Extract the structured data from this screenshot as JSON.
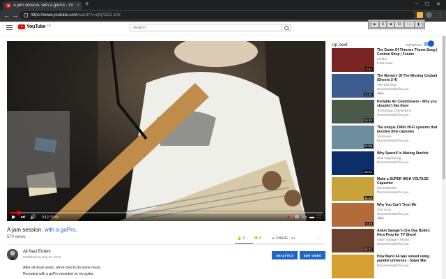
{
  "browser": {
    "tab_title": "A jam session, with a goPro - Yo",
    "tab_close": "×",
    "new_tab": "+",
    "win_min": "–",
    "win_max": "☐",
    "win_close": "✕",
    "back": "←",
    "forward": "→",
    "reload": "⟳",
    "url_host": "https://www.youtube.com",
    "url_path": "/watch?v=qfq7BZZ-10k",
    "menu": "⋮"
  },
  "extension_popup": {
    "buttons": [
      "▶",
      "A",
      "■",
      "1x",
      "↑↓↓",
      "▮"
    ]
  },
  "header": {
    "logo_text": "YouTube",
    "logo_country": "FR",
    "search_placeholder": "Search"
  },
  "player": {
    "time": "0:12 / 6:43",
    "progress": 0.03,
    "controls": {
      "play": "▶",
      "next": "⏭",
      "volume": "🔊",
      "autoplay_dot": "●",
      "settings": "⚙",
      "miniplayer": "▭",
      "theater": "▬",
      "cast": "⎚",
      "fullscreen": "⛶"
    }
  },
  "video": {
    "title_pre": "A jam session, ",
    "title_hl": "with a goPro",
    "title_post": ".",
    "views": "574 views",
    "likes": "3",
    "dislikes": "0",
    "share": "SHARE",
    "more": "···",
    "like_ratio": 1.0
  },
  "channel": {
    "name": "Ali Naci Erdem",
    "published": "Published on Sep 23, 2013",
    "analytics_button": "ANALYTICS",
    "edit_button": "EDIT VIDEO",
    "description": [
      "After all those years, we've tried to do some music.",
      "Recorded with a goPro mounted on my guitar."
    ]
  },
  "sidebar": {
    "up_next": "Up next",
    "autoplay": "AUTOPLAY",
    "autoplay_on": true,
    "items": [
      {
        "title": "The Game Of Thrones Theme Song | Custom Shop | Fender",
        "channel": "Fender",
        "meta": "8.2M views",
        "duration": "2:17",
        "thumb_color": "#7a2424"
      },
      {
        "title": "The Mystery Of The Missing Coolant (Sheero 2-4)",
        "channel": "This Old Tony",
        "meta": "Recommended for you",
        "new": "New",
        "duration": "13:40",
        "thumb_color": "#3b5c8c"
      },
      {
        "title": "Portable Air Conditioners - Why you shouldn't like them",
        "channel": "Technology Connections",
        "meta": "Recommended for you",
        "duration": "16:48",
        "thumb_color": "#4a5a4a"
      },
      {
        "title": "The unique 1960s Hi-Fi systems that become time capsules",
        "channel": "Techmoan",
        "meta": "Recommended for you",
        "duration": "21:26",
        "thumb_color": "#6d8e9e"
      },
      {
        "title": "Why SpaceX is Making Starlink",
        "channel": "Real Engineering",
        "meta": "Recommended for you",
        "duration": "16:01",
        "thumb_color": "#0d2d6b"
      },
      {
        "title": "Make a SUPER HIGH VOLTAGE Capacitor",
        "channel": "ElectroBOOM",
        "meta": "Recommended for you",
        "duration": "11:18",
        "thumb_color": "#c8a23a"
      },
      {
        "title": "Why You Can't Trust Me",
        "channel": "Tom Scott",
        "meta": "Recommended for you",
        "new": "New",
        "duration": "5:48",
        "thumb_color": "#b56a3a"
      },
      {
        "title": "Adam Savage's One Day Builds: Hero Prop for TV Show!",
        "channel": "Adam Savage's Tested",
        "meta": "Recommended for you",
        "duration": "55:31",
        "thumb_color": "#6a4030"
      },
      {
        "title": "How Mario 64 was solved using parallel universes - Super Mar",
        "channel": "Recommended for you",
        "meta": "",
        "duration": "",
        "thumb_color": "#d8a030"
      }
    ]
  }
}
